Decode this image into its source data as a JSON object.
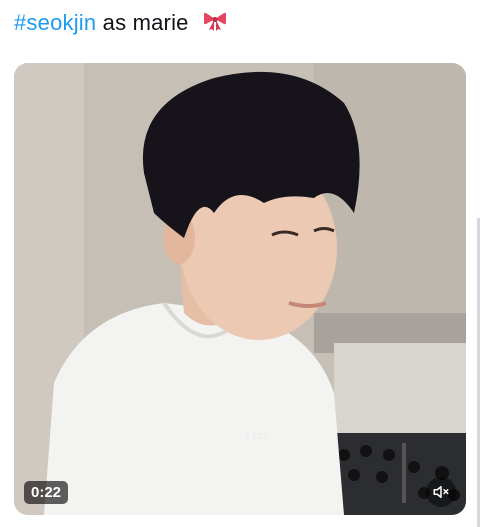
{
  "post": {
    "hashtag": "#seokjin",
    "text": "as marie",
    "emoji": "ribbon-icon"
  },
  "video": {
    "duration": "0:22",
    "watermark": "zjin",
    "muted": true
  },
  "colors": {
    "link": "#1d9bf0",
    "text": "#0f1419"
  }
}
